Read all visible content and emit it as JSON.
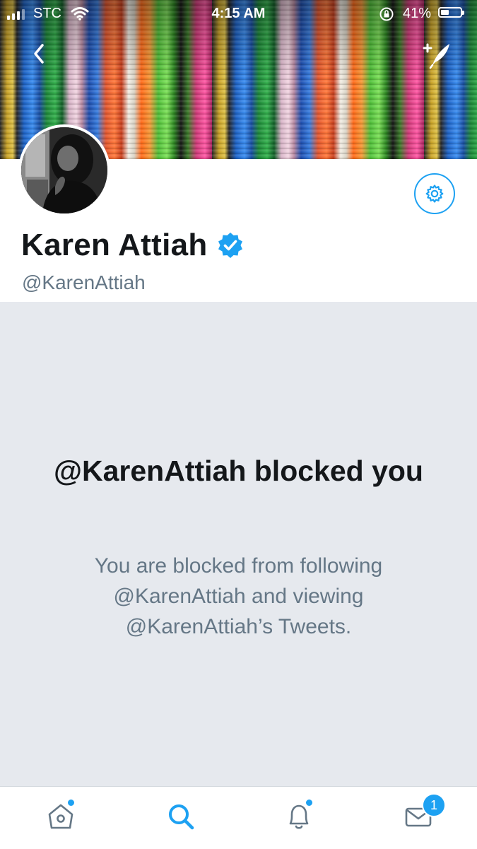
{
  "status_bar": {
    "carrier": "STC",
    "time": "4:15 AM",
    "battery_percent": "41%",
    "battery_level": 0.41
  },
  "nav": {
    "back_icon": "chevron-left-icon",
    "compose_icon": "compose-tweet-icon"
  },
  "profile": {
    "display_name": "Karen Attiah",
    "handle": "@KarenAttiah",
    "verified": true,
    "verified_icon": "verified-badge-icon",
    "settings_icon": "gear-icon"
  },
  "blocked": {
    "title": "@KarenAttiah blocked you",
    "description": "You are blocked from following @KarenAttiah and viewing @KarenAttiah’s Tweets."
  },
  "tab_bar": {
    "items": [
      {
        "name": "home",
        "icon": "home-icon",
        "active": false,
        "has_dot": true
      },
      {
        "name": "search",
        "icon": "search-icon",
        "active": true,
        "has_dot": false
      },
      {
        "name": "notifications",
        "icon": "bell-icon",
        "active": false,
        "has_dot": true
      },
      {
        "name": "messages",
        "icon": "envelope-icon",
        "active": false,
        "badge": "1"
      }
    ]
  },
  "colors": {
    "accent": "#1da1f2",
    "text_primary": "#14171a",
    "text_secondary": "#657786",
    "blocked_background": "#e6e9ee"
  }
}
